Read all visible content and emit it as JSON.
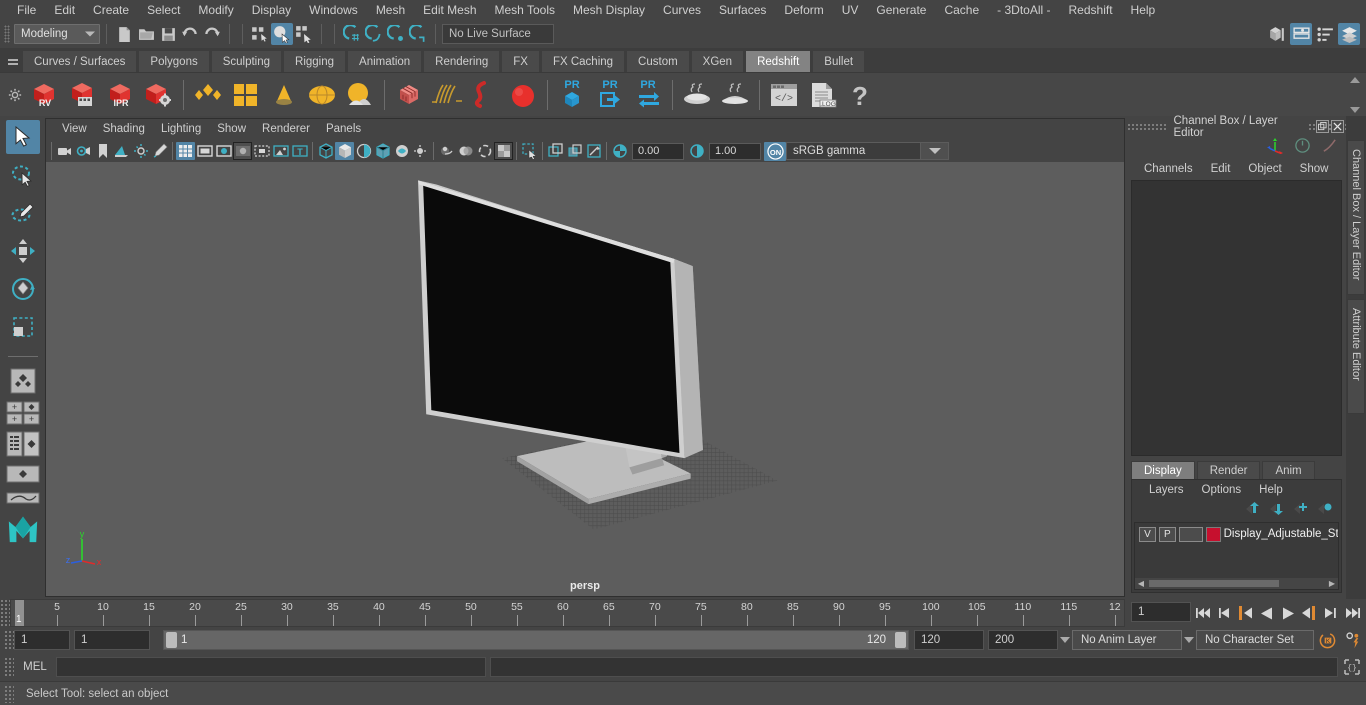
{
  "menubar": {
    "items": [
      "File",
      "Edit",
      "Create",
      "Select",
      "Modify",
      "Display",
      "Windows",
      "Mesh",
      "Edit Mesh",
      "Mesh Tools",
      "Mesh Display",
      "Curves",
      "Surfaces",
      "Deform",
      "UV",
      "Generate",
      "Cache",
      "- 3DtoAll -",
      "Redshift",
      "Help"
    ]
  },
  "statusline": {
    "mode": "Modeling",
    "live_surface": "No Live Surface",
    "icons": [
      "new-scene-icon",
      "open-scene-icon",
      "save-scene-icon",
      "undo-icon",
      "redo-icon",
      "select-hierarchy-icon",
      "select-object-icon",
      "select-component-icon",
      "snap-grid-icon",
      "snap-curve-icon",
      "snap-point-icon",
      "snap-projected-icon",
      "render-view-icon",
      "render-icon",
      "ipr-render-icon",
      "render-settings-icon"
    ],
    "right_icons": [
      "show-hide-modeling-toolkit-icon",
      "show-hide-attribute-editor-icon",
      "show-hide-tool-settings-icon",
      "show-hide-channel-box-icon"
    ]
  },
  "shelf": {
    "tabs": [
      "Curves / Surfaces",
      "Polygons",
      "Sculpting",
      "Rigging",
      "Animation",
      "Rendering",
      "FX",
      "FX Caching",
      "Custom",
      "XGen",
      "Redshift",
      "Bullet"
    ],
    "active_tab": "Redshift",
    "buttons": [
      {
        "name": "redshift-render-view-icon",
        "label": "RV"
      },
      {
        "name": "redshift-render-sequence-icon",
        "label": ""
      },
      {
        "name": "redshift-ipr-icon",
        "label": "IPR"
      },
      {
        "name": "redshift-render-settings-icon",
        "label": ""
      },
      {
        "name": "redshift-lights-icon",
        "label": ""
      },
      {
        "name": "redshift-area-light-icon",
        "label": ""
      },
      {
        "name": "redshift-ies-light-icon",
        "label": ""
      },
      {
        "name": "redshift-dome-light-icon",
        "label": ""
      },
      {
        "name": "redshift-physical-sun-icon",
        "label": ""
      },
      {
        "name": "redshift-proxy-icon",
        "label": ""
      },
      {
        "name": "redshift-hair-icon",
        "label": ""
      },
      {
        "name": "redshift-curve-icon",
        "label": ""
      },
      {
        "name": "redshift-sphere-icon",
        "label": ""
      },
      {
        "name": "redshift-pr-object-icon",
        "label": "PR"
      },
      {
        "name": "redshift-pr-export-icon",
        "label": "PR"
      },
      {
        "name": "redshift-pr-transfer-icon",
        "label": "PR"
      },
      {
        "name": "redshift-bake-icon",
        "label": ""
      },
      {
        "name": "redshift-bake-set-icon",
        "label": ""
      },
      {
        "name": "redshift-script-editor-icon",
        "label": ""
      },
      {
        "name": "redshift-log-icon",
        "label": ".LOG"
      },
      {
        "name": "redshift-help-icon",
        "label": "?"
      }
    ]
  },
  "toolbox": {
    "tools": [
      "select-tool",
      "lasso-select-tool",
      "paint-select-tool",
      "move-tool",
      "rotate-tool",
      "scale-tool"
    ],
    "layouts": [
      "single-perspective-layout",
      "four-view-layout",
      "outliner-persp-layout",
      "hypergraph-persp-layout",
      "persp-graph-layout"
    ]
  },
  "viewport": {
    "menus": [
      "View",
      "Shading",
      "Lighting",
      "Show",
      "Renderer",
      "Panels"
    ],
    "camera_label": "persp",
    "exposure": "0.00",
    "gamma": "1.00",
    "color_mgmt": "sRGB gamma",
    "color_mgmt_enabled": "ON",
    "axis": {
      "x": "x",
      "y": "y",
      "z": "z"
    },
    "toolbar_icons": [
      "select-camera-icon",
      "camera-attributes-icon",
      "bookmark-icon",
      "image-plane-icon",
      "two-sided-lighting-icon",
      "paint-effects-icon",
      "grid-icon",
      "film-gate-icon",
      "resolution-gate-icon",
      "gate-mask-icon",
      "film-origin-icon",
      "image-plane-display-icon",
      "text-display-icon",
      "wireframe-icon",
      "smooth-shade-icon",
      "flat-shade-icon",
      "shaded-wireframe-icon",
      "textured-icon",
      "use-default-light-icon",
      "shadows-icon",
      "ambient-occlusion-icon",
      "motion-blur-icon",
      "multisample-icon",
      "depth-of-field-icon",
      "isolate-select-icon",
      "xray-icon",
      "xray-joints-icon",
      "xray-active-components-icon",
      "exposure-icon",
      "gamma-icon",
      "color-management-icon"
    ]
  },
  "channelbox": {
    "title": "Channel Box / Layer Editor",
    "menus": [
      "Channels",
      "Edit",
      "Object",
      "Show"
    ],
    "header_icons": [
      "axis-manip-icon",
      "channel-speed-icon",
      "channel-curve-icon"
    ],
    "window_buttons": [
      "undock-icon",
      "close-icon"
    ]
  },
  "layereditor": {
    "tabs": [
      "Display",
      "Render",
      "Anim"
    ],
    "active_tab": "Display",
    "menus": [
      "Layers",
      "Options",
      "Help"
    ],
    "toolbar_icons": [
      "move-layer-up-icon",
      "move-layer-down-icon",
      "new-layer-icon",
      "new-layer-from-selected-icon"
    ],
    "layers": [
      {
        "visibility": "V",
        "playback": "P",
        "shading": "",
        "color": "#c6102e",
        "name": "Display_Adjustable_St"
      }
    ]
  },
  "vtabs": [
    "Channel Box / Layer Editor",
    "Attribute Editor"
  ],
  "timeline": {
    "ticks": [
      5,
      10,
      15,
      20,
      25,
      30,
      35,
      40,
      45,
      50,
      55,
      60,
      65,
      70,
      75,
      80,
      85,
      90,
      95,
      100,
      105,
      110,
      115,
      "12"
    ],
    "current_frame": "1",
    "frame_field": "1",
    "playback_buttons": [
      "go-to-start-icon",
      "step-back-keyframe-icon",
      "step-back-frame-icon",
      "play-backwards-icon",
      "play-forwards-icon",
      "step-forward-frame-icon",
      "step-forward-keyframe-icon",
      "go-to-end-icon"
    ]
  },
  "range": {
    "anim_start": "1",
    "range_start": "1",
    "slider_start_label": "1",
    "slider_end_label": "120",
    "range_end": "120",
    "anim_end": "200",
    "anim_layer": "No Anim Layer",
    "character_set": "No Character Set",
    "icons": [
      "auto-keyframe-icon",
      "animation-preferences-icon"
    ]
  },
  "mel": {
    "label": "MEL",
    "input_value": "",
    "output_value": "",
    "icon": "script-editor-icon"
  },
  "helpline": {
    "text": "Select Tool: select an object"
  },
  "colors": {
    "accent_blue": "#5285a6",
    "redshift_red": "#d42a27",
    "shelf_yellow": "#f0b429",
    "layer_red": "#c6102e",
    "orange": "#e08a33",
    "bg": "#444444",
    "viewport_bg": "#5d5d5d"
  }
}
